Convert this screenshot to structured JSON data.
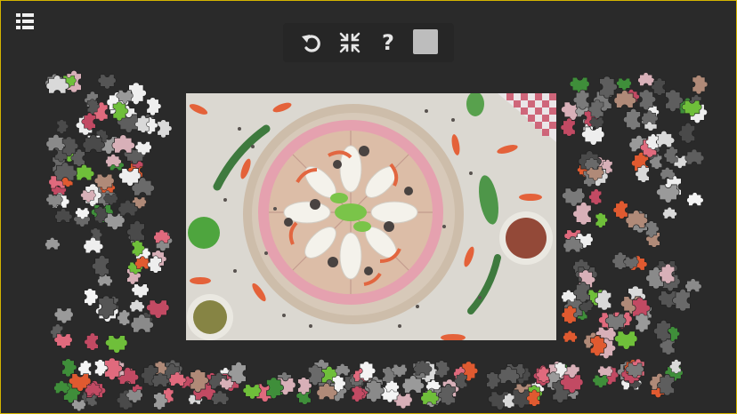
{
  "app": {
    "toolbar": {
      "menu_icon": "menu-list-icon",
      "undo_icon": "undo-icon",
      "shrink_icon": "shrink-icon",
      "help_icon": "help-icon",
      "help_glyph": "?",
      "preview_icon": "preview-square-icon"
    },
    "puzzle": {
      "image_subject": "pizza",
      "scattered": true
    },
    "colors": {
      "background": "#2a2a2a",
      "frame_border": "#d4b400",
      "toolbar_bg": "#262626",
      "icon": "#e6e6e6",
      "preview_square": "#bdbdbd"
    }
  }
}
